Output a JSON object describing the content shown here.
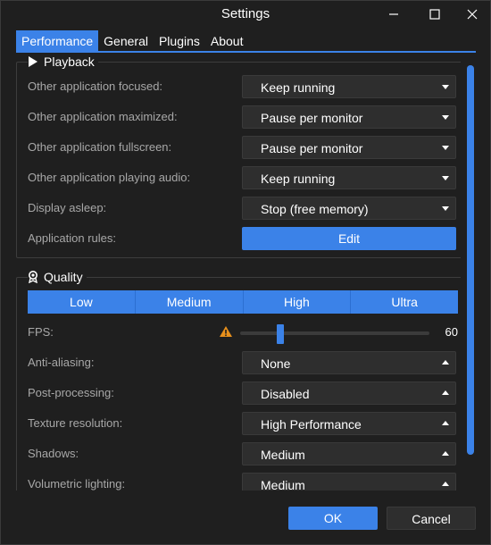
{
  "window": {
    "title": "Settings"
  },
  "tabs": [
    {
      "label": "Performance",
      "active": true
    },
    {
      "label": "General",
      "active": false
    },
    {
      "label": "Plugins",
      "active": false
    },
    {
      "label": "About",
      "active": false
    }
  ],
  "playback": {
    "title": "Playback",
    "rows": [
      {
        "label": "Other application focused:",
        "value": "Keep running"
      },
      {
        "label": "Other application maximized:",
        "value": "Pause per monitor"
      },
      {
        "label": "Other application fullscreen:",
        "value": "Pause per monitor"
      },
      {
        "label": "Other application playing audio:",
        "value": "Keep running"
      },
      {
        "label": "Display asleep:",
        "value": "Stop (free memory)"
      }
    ],
    "rules_label": "Application rules:",
    "rules_button": "Edit"
  },
  "quality": {
    "title": "Quality",
    "presets": [
      "Low",
      "Medium",
      "High",
      "Ultra"
    ],
    "fps_label": "FPS:",
    "fps_value": "60",
    "fps_fraction": 0.2,
    "rows": [
      {
        "label": "Anti-aliasing:",
        "value": "None"
      },
      {
        "label": "Post-processing:",
        "value": "Disabled"
      },
      {
        "label": "Texture resolution:",
        "value": "High Performance"
      },
      {
        "label": "Shadows:",
        "value": "Medium"
      },
      {
        "label": "Volumetric lighting:",
        "value": "Medium"
      }
    ]
  },
  "footer": {
    "ok": "OK",
    "cancel": "Cancel"
  },
  "colors": {
    "accent": "#3b82e8",
    "warning": "#e8901c"
  }
}
